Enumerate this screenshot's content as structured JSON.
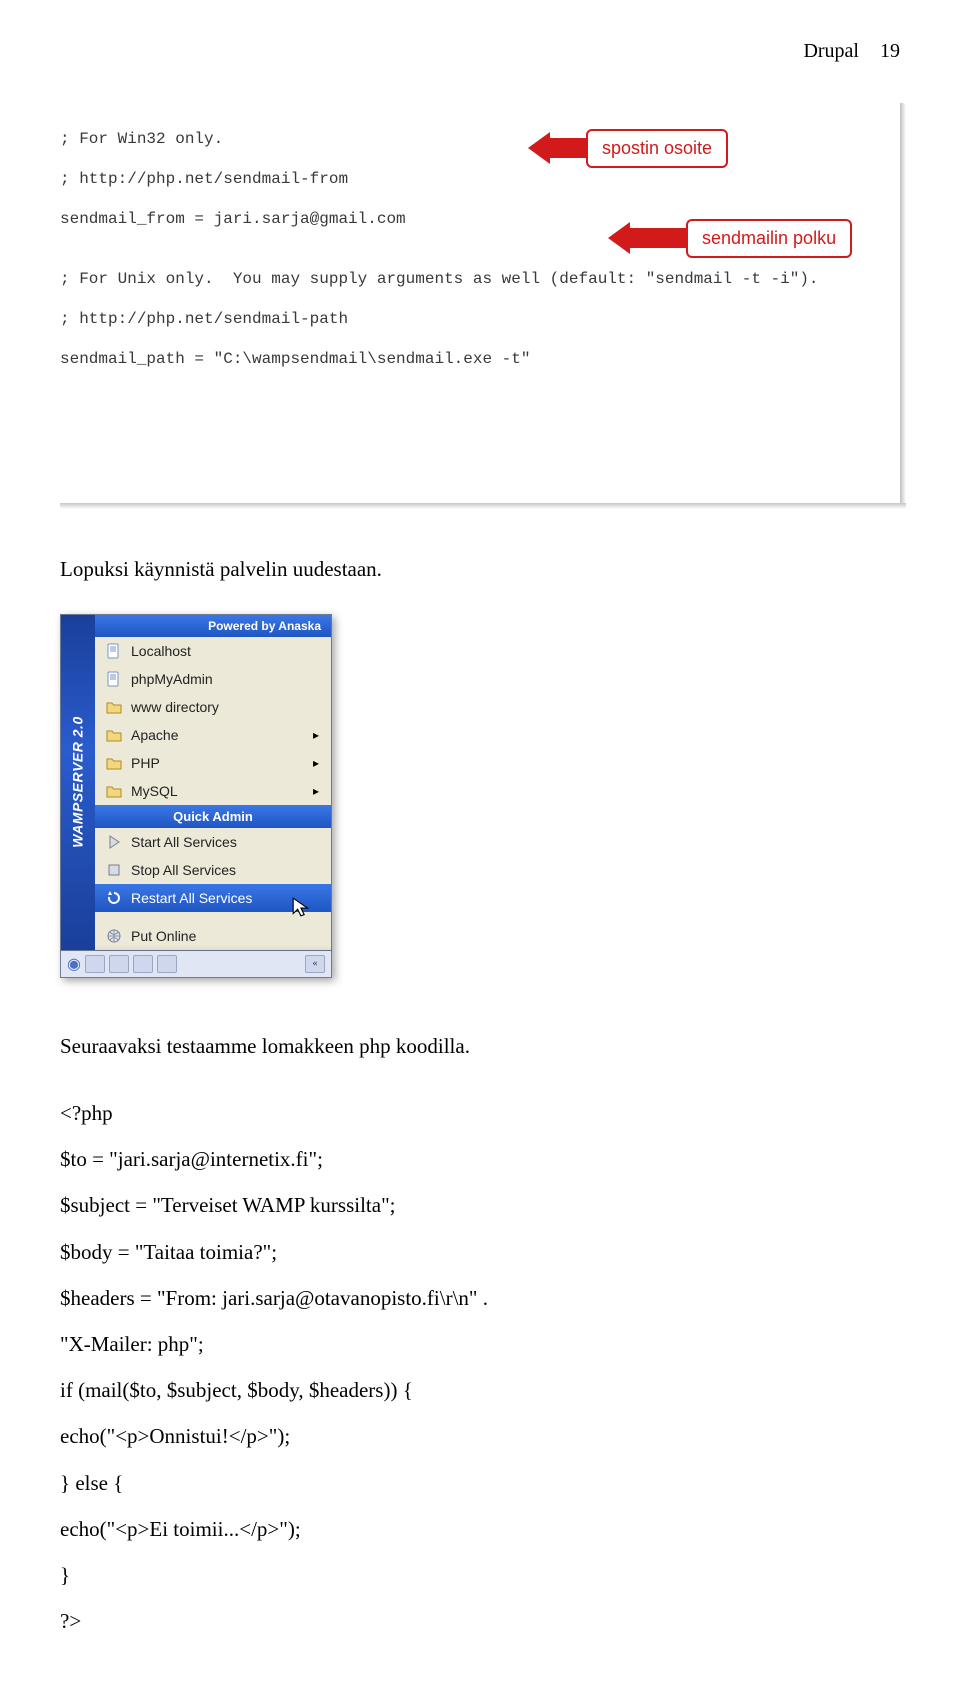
{
  "header": {
    "title": "Drupal",
    "page": "19"
  },
  "codeblock": {
    "lines": [
      "; For Win32 only.",
      "; http://php.net/sendmail-from",
      "sendmail_from = jari.sarja@gmail.com",
      "",
      "; For Unix only.  You may supply arguments as well (default: \"sendmail -t -i\").",
      "; http://php.net/sendmail-path",
      "sendmail_path = \"C:\\wampsendmail\\sendmail.exe -t\""
    ],
    "callout1": "spostin osoite",
    "callout2": "sendmailin polku"
  },
  "para1": "Lopuksi käynnistä palvelin uudestaan.",
  "wamp": {
    "side": "WAMPSERVER 2.0",
    "powered": "Powered by Anaska",
    "items": [
      {
        "label": "Localhost",
        "type": "page"
      },
      {
        "label": "phpMyAdmin",
        "type": "page"
      },
      {
        "label": "www directory",
        "type": "folder"
      },
      {
        "label": "Apache",
        "type": "folder",
        "sub": true
      },
      {
        "label": "PHP",
        "type": "folder",
        "sub": true
      },
      {
        "label": "MySQL",
        "type": "folder",
        "sub": true
      }
    ],
    "quick_admin": "Quick Admin",
    "admin": [
      "Start All Services",
      "Stop All Services",
      "Restart All Services"
    ],
    "put_online": "Put Online",
    "hovered_index": 2
  },
  "para2": "Seuraavaksi testaamme lomakkeen php koodilla.",
  "php": {
    "lines": [
      "<?php",
      "$to = \"jari.sarja@internetix.fi\";",
      "$subject = \"Terveiset WAMP kurssilta\";",
      "$body = \"Taitaa toimia?\";",
      "$headers = \"From: jari.sarja@otavanopisto.fi\\r\\n\" .",
      "\"X-Mailer: php\";",
      "if (mail($to, $subject, $body, $headers)) {",
      "echo(\"<p>Onnistui!</p>\");",
      "} else {",
      "echo(\"<p>Ei toimii...</p>\");",
      "}",
      "?>"
    ]
  }
}
